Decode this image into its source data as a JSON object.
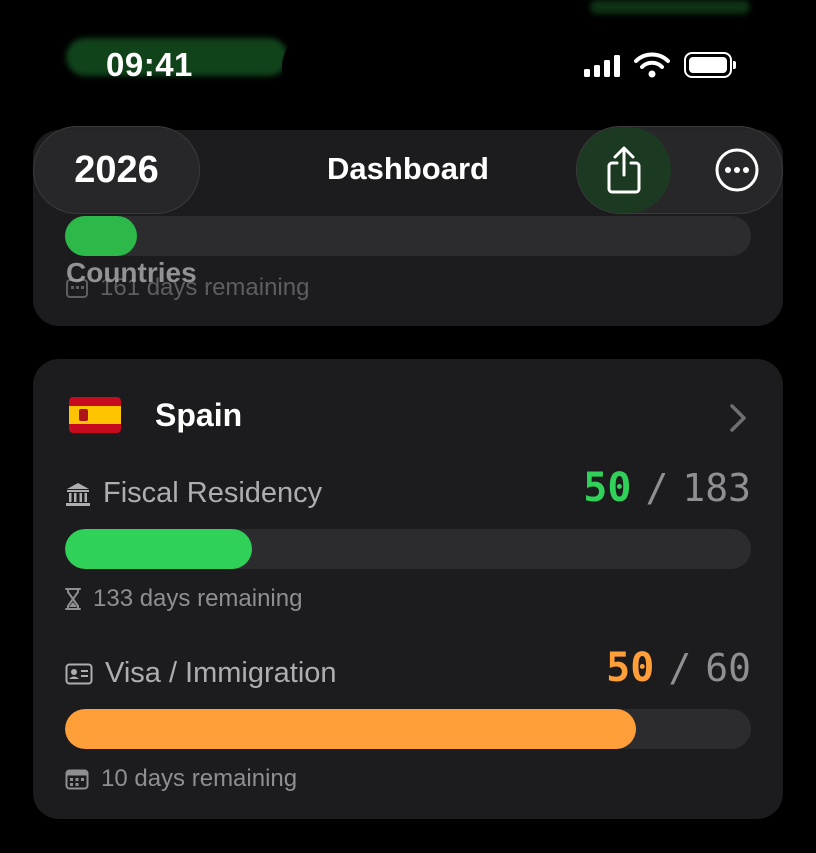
{
  "status_bar": {
    "time": "09:41"
  },
  "header": {
    "year": "2026",
    "title": "Dashboard",
    "share_icon": "share-icon",
    "more_icon": "ellipsis-circle-icon"
  },
  "background_card": {
    "label": "Countries",
    "remaining": "161 days remaining"
  },
  "country_card": {
    "flag": "spain-flag-icon",
    "name": "Spain",
    "metrics": [
      {
        "icon": "bank-icon",
        "label": "Fiscal Residency",
        "used": "50",
        "limit": "183",
        "progress": 0.273,
        "color": "#30d158",
        "remaining_icon": "hourglass-icon",
        "remaining": "133 days remaining"
      },
      {
        "icon": "id-card-icon",
        "label": "Visa / Immigration",
        "used": "50",
        "limit": "60",
        "progress": 0.833,
        "color": "#ff9f3a",
        "remaining_icon": "calendar-icon",
        "remaining": "10 days remaining"
      }
    ]
  },
  "colors": {
    "background": "#000000",
    "card": "#1c1c1e",
    "track": "#2c2c2e",
    "green": "#30d158",
    "orange": "#ff9f3a"
  }
}
